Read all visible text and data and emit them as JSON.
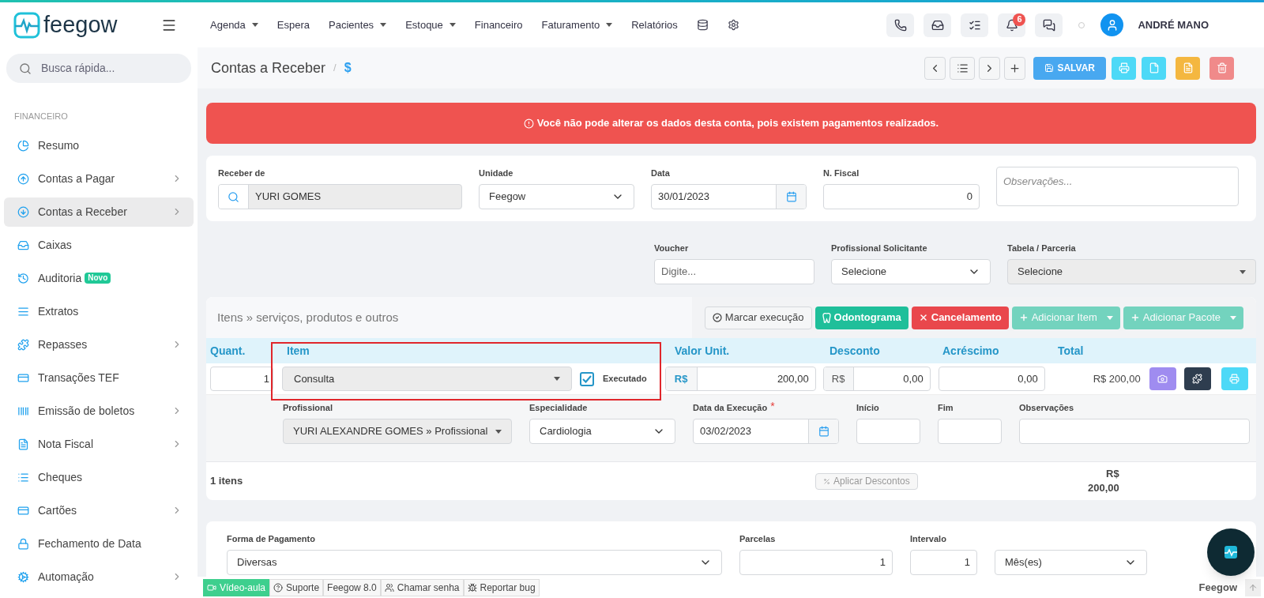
{
  "brand": {
    "name": "feegow"
  },
  "nav": [
    {
      "label": "Agenda",
      "dropdown": true
    },
    {
      "label": "Espera",
      "dropdown": false
    },
    {
      "label": "Pacientes",
      "dropdown": true
    },
    {
      "label": "Estoque",
      "dropdown": true
    },
    {
      "label": "Financeiro",
      "dropdown": false
    },
    {
      "label": "Faturamento",
      "dropdown": true
    },
    {
      "label": "Relatórios",
      "dropdown": false
    }
  ],
  "notifications": {
    "badge": "6"
  },
  "user": {
    "name": "ANDRÉ MANO"
  },
  "search": {
    "placeholder": "Busca rápida..."
  },
  "sidebar": {
    "section": "FINANCEIRO",
    "items": [
      {
        "label": "Resumo",
        "expandable": false,
        "selected": false
      },
      {
        "label": "Contas a Pagar",
        "expandable": true,
        "selected": false
      },
      {
        "label": "Contas a Receber",
        "expandable": true,
        "selected": true
      },
      {
        "label": "Caixas",
        "expandable": false,
        "selected": false
      },
      {
        "label": "Auditoria",
        "expandable": false,
        "selected": false,
        "badge": "Novo"
      },
      {
        "label": "Extratos",
        "expandable": false,
        "selected": false
      },
      {
        "label": "Repasses",
        "expandable": true,
        "selected": false
      },
      {
        "label": "Transações TEF",
        "expandable": false,
        "selected": false
      },
      {
        "label": "Emissão de boletos",
        "expandable": true,
        "selected": false
      },
      {
        "label": "Nota Fiscal",
        "expandable": true,
        "selected": false
      },
      {
        "label": "Cheques",
        "expandable": false,
        "selected": false
      },
      {
        "label": "Cartões",
        "expandable": true,
        "selected": false
      },
      {
        "label": "Fechamento de Data",
        "expandable": false,
        "selected": false
      },
      {
        "label": "Automação",
        "expandable": true,
        "selected": false
      }
    ]
  },
  "page": {
    "title": "Contas a Receber",
    "separator": "/",
    "crumb": "$",
    "save_label": "SALVAR"
  },
  "alert": {
    "text": "Você não pode alterar os dados desta conta, pois existem pagamentos realizados."
  },
  "account_fields": [
    {
      "label": "Receber de",
      "kind": "search",
      "value": "YURI GOMES",
      "disabled": true
    },
    {
      "label": "Unidade",
      "kind": "select",
      "value": "Feegow",
      "disabled": false
    },
    {
      "label": "Data",
      "kind": "date",
      "value": "30/01/2023",
      "disabled": false
    },
    {
      "label": "N. Fiscal",
      "kind": "number",
      "value": "0",
      "disabled": false
    },
    {
      "kind": "textarea",
      "placeholder": "Observações...",
      "disabled": false
    }
  ],
  "extra_fields": [
    {
      "label": "Voucher",
      "kind": "text",
      "placeholder": "Digite...",
      "disabled": false
    },
    {
      "label": "Profissional Solicitante",
      "kind": "select",
      "value": "Selecione",
      "disabled": false
    },
    {
      "label": "Tabela / Parceria",
      "kind": "select",
      "value": "Selecione",
      "disabled": true
    }
  ],
  "items": {
    "title": "Itens » serviços, produtos e outros",
    "actions": [
      {
        "label": "Marcar execução",
        "kind": "mark",
        "disabled": false
      },
      {
        "label": "Odontograma",
        "kind": "tooth",
        "disabled": false
      },
      {
        "label": "Cancelamento",
        "kind": "cancel",
        "disabled": false
      },
      {
        "label": "Adicionar Item",
        "kind": "add",
        "disabled": true
      },
      {
        "label": "Adicionar Pacote",
        "kind": "add",
        "disabled": true
      }
    ],
    "columns": [
      "Quant.",
      "Item",
      "Valor Unit.",
      "Desconto",
      "Acréscimo",
      "Total"
    ],
    "row": {
      "quantity": "1",
      "item": "Consulta",
      "executed": true,
      "executed_label": "Executado",
      "unit_currency": "R$",
      "unit_value": "200,00",
      "discount_currency": "R$",
      "discount": "0,00",
      "addition": "0,00",
      "total": "R$ 200,00"
    },
    "details": [
      {
        "label": "Profissional",
        "kind": "select",
        "value": "YURI ALEXANDRE GOMES » Profissional",
        "disabled": true
      },
      {
        "label": "Especialidade",
        "kind": "select",
        "value": "Cardiologia",
        "disabled": false
      },
      {
        "label": "Data da Execução",
        "kind": "date",
        "value": "03/02/2023",
        "disabled": false,
        "required_mark": "*"
      },
      {
        "label": "Início",
        "kind": "text",
        "disabled": false
      },
      {
        "label": "Fim",
        "kind": "text",
        "disabled": false
      },
      {
        "label": "Observações",
        "kind": "text",
        "disabled": false
      }
    ],
    "footer": {
      "count": "1 itens",
      "discount_button": "Aplicar Descontos",
      "total_currency": "R$",
      "total": "200,00"
    }
  },
  "payment_fields": [
    {
      "label": "Forma de Pagamento",
      "kind": "select",
      "value": "Diversas",
      "disabled": false
    },
    {
      "label": "Parcelas",
      "kind": "number",
      "value": "1",
      "disabled": false
    },
    {
      "label": "Intervalo",
      "kind": "number",
      "value": "1",
      "disabled": false
    },
    {
      "kind": "select",
      "value": "Mês(es)",
      "disabled": false
    }
  ],
  "bottom_bar": {
    "links": [
      {
        "label": "Vídeo-aula",
        "kind": "video"
      },
      {
        "label": "Suporte",
        "kind": "help"
      },
      {
        "label": "Feegow 8.0",
        "kind": "plain"
      },
      {
        "label": "Chamar senha",
        "kind": "users"
      },
      {
        "label": "Reportar bug",
        "kind": "bug"
      }
    ],
    "brand": "Feegow"
  }
}
